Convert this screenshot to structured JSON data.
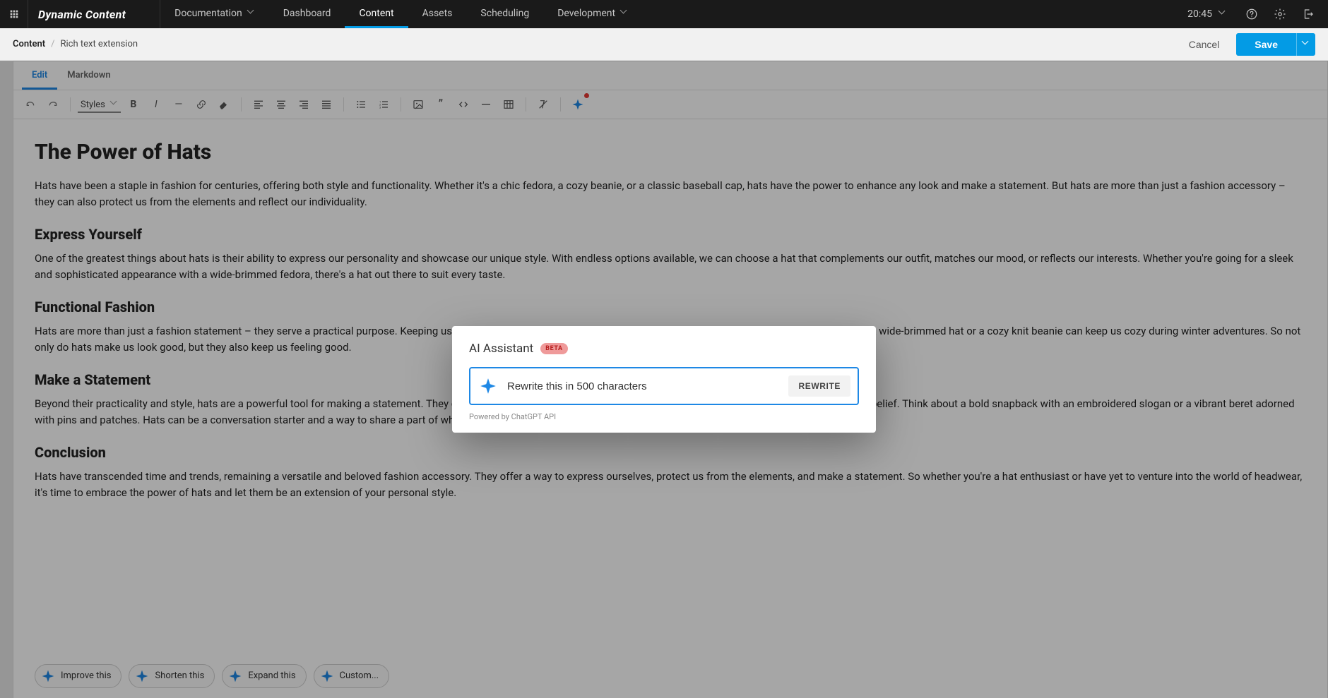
{
  "brand": "Dynamic Content",
  "nav": {
    "documentation": "Documentation",
    "dashboard": "Dashboard",
    "content": "Content",
    "assets": "Assets",
    "scheduling": "Scheduling",
    "development": "Development"
  },
  "clock": "20:45",
  "breadcrumb": {
    "root": "Content",
    "leaf": "Rich text extension"
  },
  "actions": {
    "cancel": "Cancel",
    "save": "Save"
  },
  "editor": {
    "tabs": {
      "edit": "Edit",
      "markdown": "Markdown"
    },
    "styles_label": "Styles",
    "content": {
      "h1": "The Power of Hats",
      "p1": "Hats have been a staple in fashion for centuries, offering both style and functionality. Whether it's a chic fedora, a cozy beanie, or a classic baseball cap, hats have the power to enhance any look and make a statement. But hats are more than just a fashion accessory – they can also protect us from the elements and reflect our individuality.",
      "h2a": "Express Yourself",
      "p2": "One of the greatest things about hats is their ability to express our personality and showcase our unique style. With endless options available, we can choose a hat that complements our outfit, matches our mood, or reflects our interests. Whether you're going for a sleek and sophisticated appearance with a wide-brimmed fedora, there's a hat out there to suit every taste.",
      "h2b": "Functional Fashion",
      "p3": "Hats are more than just a fashion statement – they serve a practical purpose. Keeping us warm in chilly weather, hats are essential accessories that offer protection and comfort. A wide-brimmed hat or a cozy knit beanie can keep us cozy during winter adventures. So not only do hats make us look good, but they also keep us feeling good.",
      "h2c": "Make a Statement",
      "p4": "Beyond their practicality and style, hats are a powerful tool for making a statement. They can signal allegiance to a sports team, represent a cultural heritage, or display a personal belief. Think about a bold snapback with an embroidered slogan or a vibrant beret adorned with pins and patches. Hats can be a conversation starter and a way to share a part of who we are with the world.",
      "h2d": "Conclusion",
      "p5": "Hats have transcended time and trends, remaining a versatile and beloved fashion accessory. They offer a way to express ourselves, protect us from the elements, and make a statement. So whether you're a hat enthusiast or have yet to venture into the world of headwear, it's time to embrace the power of hats and let them be an extension of your personal style."
    },
    "chips": {
      "improve": "Improve this",
      "shorten": "Shorten this",
      "expand": "Expand this",
      "custom": "Custom..."
    }
  },
  "modal": {
    "title": "AI Assistant",
    "badge": "BETA",
    "prompt": "Rewrite this in 500 characters",
    "button": "REWRITE",
    "powered": "Powered by ChatGPT API"
  }
}
